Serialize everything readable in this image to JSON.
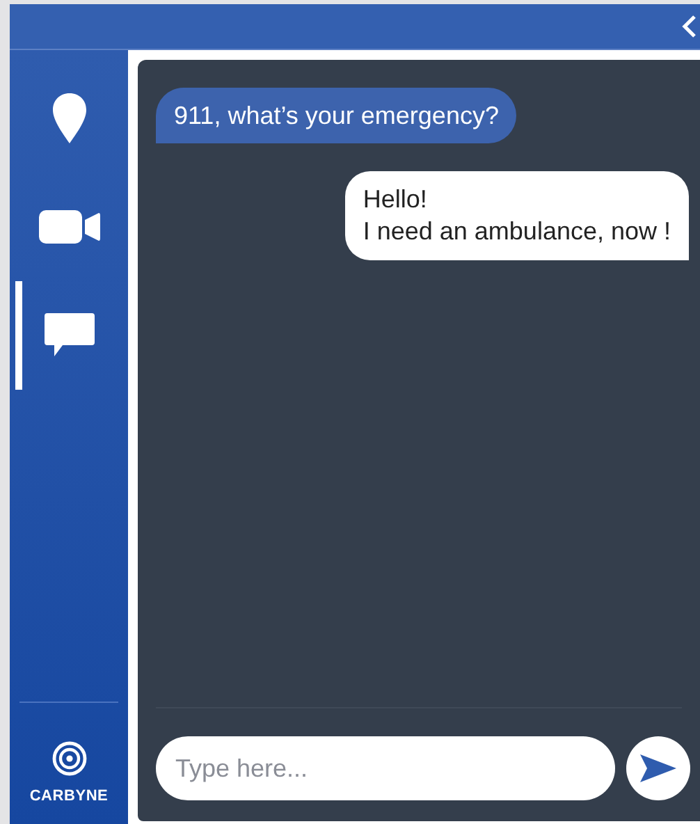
{
  "sidebar": {
    "items": [
      {
        "kind": "location",
        "selected": false
      },
      {
        "kind": "video",
        "selected": false
      },
      {
        "kind": "chat",
        "selected": true
      }
    ],
    "brand": "CARBYNE"
  },
  "messages": [
    {
      "kind": "incoming",
      "text": "911, what’s your emergency?"
    },
    {
      "kind": "outgoing",
      "text": "Hello!\nI need an ambulance, now !"
    }
  ],
  "composer": {
    "placeholder": "Type here..."
  }
}
